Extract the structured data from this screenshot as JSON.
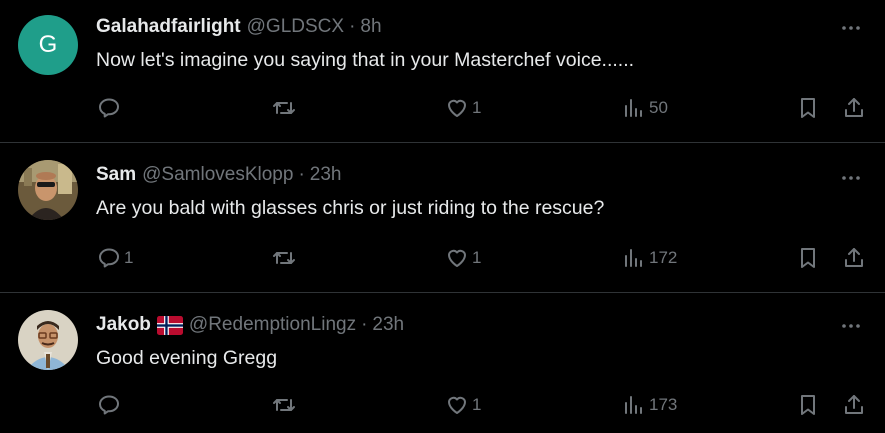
{
  "tweets": [
    {
      "name": "Galahadfairlight",
      "handle": "@GLDSCX",
      "separator": "·",
      "time": "8h",
      "text": "Now let's imagine you saying that in your Masterchef voice......",
      "avatar_letter": "G",
      "avatar_color": "#1f9e8a",
      "reply_count": "",
      "retweet_count": "",
      "like_count": "1",
      "view_count": "50",
      "has_flag": false
    },
    {
      "name": "Sam",
      "handle": "@SamlovesKlopp",
      "separator": "·",
      "time": "23h",
      "text": "Are you bald with glasses chris or just riding to the rescue?",
      "avatar_letter": "",
      "reply_count": "1",
      "retweet_count": "",
      "like_count": "1",
      "view_count": "172",
      "has_flag": false
    },
    {
      "name": "Jakob",
      "handle": "@RedemptionLingz",
      "separator": "·",
      "time": "23h",
      "text": "Good evening Gregg",
      "avatar_letter": "",
      "reply_count": "",
      "retweet_count": "",
      "like_count": "1",
      "view_count": "173",
      "has_flag": true,
      "flag_icon": "norway-flag-icon"
    }
  ],
  "icons": {
    "reply": "reply-icon",
    "retweet": "retweet-icon",
    "like": "heart-icon",
    "views": "views-icon",
    "bookmark": "bookmark-icon",
    "share": "share-icon",
    "more": "more-icon"
  },
  "colors": {
    "background": "#000000",
    "text": "#e7e9ea",
    "muted": "#71767b",
    "divider": "#2f3336"
  }
}
